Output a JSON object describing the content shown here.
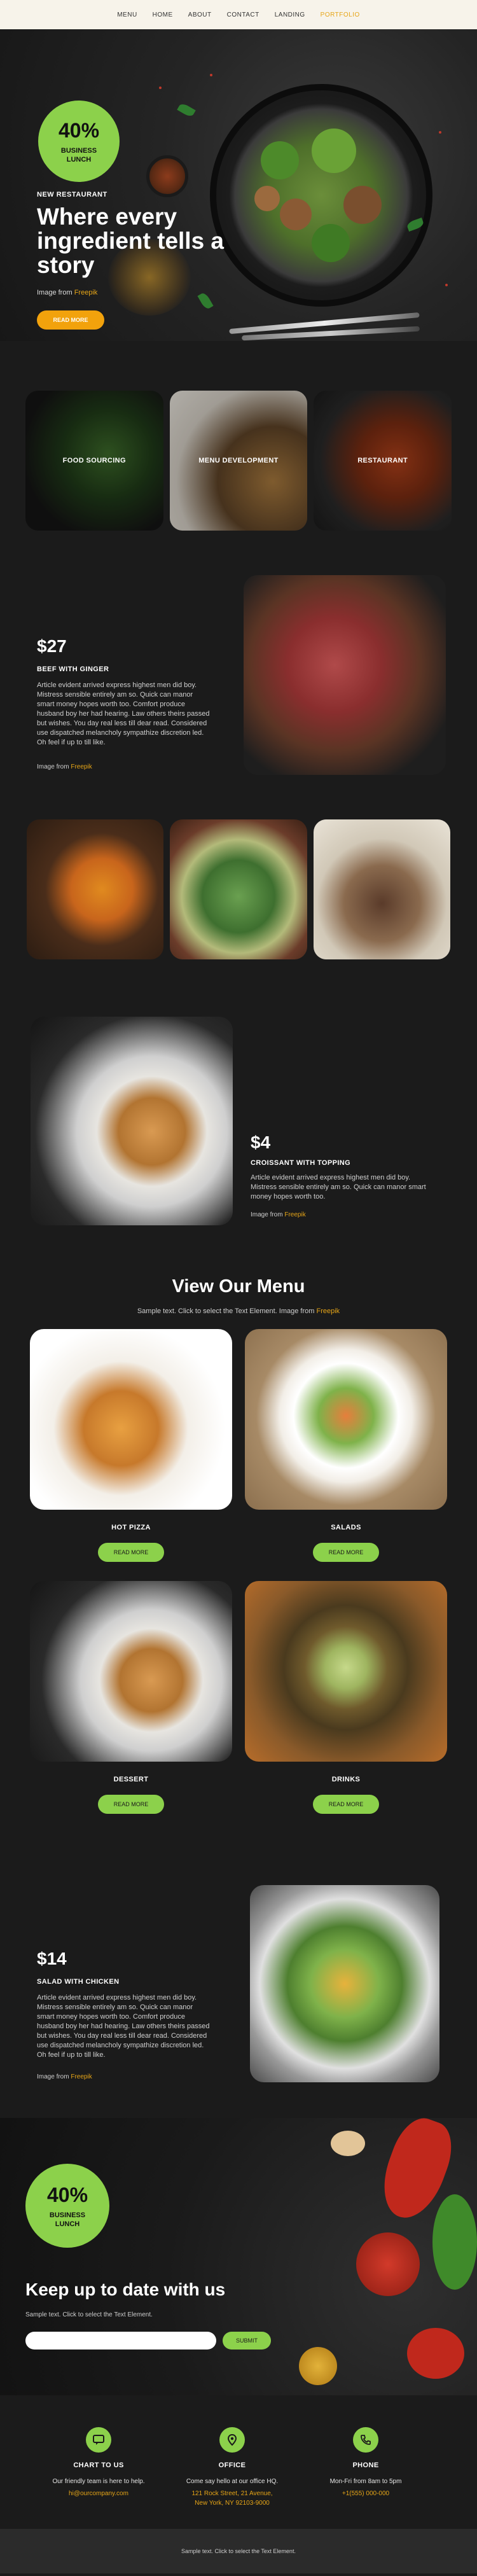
{
  "nav": {
    "items": [
      {
        "label": "MENU"
      },
      {
        "label": "HOME"
      },
      {
        "label": "ABOUT"
      },
      {
        "label": "CONTACT"
      },
      {
        "label": "LANDING"
      },
      {
        "label": "PORTFOLIO",
        "active": true
      }
    ]
  },
  "hero": {
    "badge_pct": "40%",
    "badge_line1": "BUSINESS",
    "badge_line2": "LUNCH",
    "eyebrow": "NEW RESTAURANT",
    "title": "Where every ingredient tells a story",
    "credit_prefix": "Image from",
    "credit_link": "Freepik",
    "button": "READ MORE"
  },
  "features": [
    {
      "label": "FOOD SOURCING"
    },
    {
      "label": "MENU DEVELOPMENT"
    },
    {
      "label": "RESTAURANT"
    }
  ],
  "beef": {
    "price": "$27",
    "name": "BEEF WITH GINGER",
    "text": "Article evident arrived express highest men did boy. Mistress sensible entirely am so. Quick can manor smart money hopes worth too. Comfort produce husband boy her had hearing. Law others theirs passed but wishes. You day real less till dear read. Considered use dispatched melancholy sympathize discretion led. Oh feel if up to till like.",
    "credit_prefix": "Image from",
    "credit_link": "Freepik"
  },
  "croissant": {
    "price": "$4",
    "name": "CROISSANT WITH TOPPING",
    "text": "Article evident arrived express highest men did boy. Mistress sensible entirely am so. Quick can manor smart money hopes worth too.",
    "credit_prefix": "Image from",
    "credit_link": "Freepik"
  },
  "menu": {
    "title": "View Our Menu",
    "subtitle_prefix": "Sample text. Click to select the Text Element. Image from",
    "subtitle_link": "Freepik",
    "items": [
      {
        "label": "HOT PIZZA",
        "button": "READ MORE"
      },
      {
        "label": "SALADS",
        "button": "READ MORE"
      },
      {
        "label": "DESSERT",
        "button": "READ MORE"
      },
      {
        "label": "DRINKS",
        "button": "READ MORE"
      }
    ]
  },
  "salad": {
    "price": "$14",
    "name": "SALAD WITH CHICKEN",
    "text": "Article evident arrived express highest men did boy. Mistress sensible entirely am so. Quick can manor smart money hopes worth too. Comfort produce husband boy her had hearing. Law others theirs passed but wishes. You day real less till dear read. Considered use dispatched melancholy sympathize discretion led. Oh feel if up to till like.",
    "credit_prefix": "Image from",
    "credit_link": "Freepik"
  },
  "newsletter": {
    "badge_pct": "40%",
    "badge_line1": "BUSINESS",
    "badge_line2": "LUNCH",
    "title": "Keep up to date with us",
    "subtitle": "Sample text. Click to select the Text Element.",
    "email_value": "",
    "button": "SUBMIT"
  },
  "contact": [
    {
      "title": "CHART TO US",
      "line": "Our friendly team is here to help.",
      "link": "hi@ourcompany.com",
      "icon": "chat-icon"
    },
    {
      "title": "OFFICE",
      "line": "Come say hello at our office HQ.",
      "link": "121 Rock Street, 21 Avenue,",
      "link2": "New York, NY 92103-9000",
      "icon": "location-pin-icon"
    },
    {
      "title": "PHONE",
      "line": "Mon-Fri from 8am to 5pm",
      "link": "+1(555) 000-000",
      "icon": "phone-icon"
    }
  ],
  "footer": {
    "text": "Sample text. Click to select the Text Element."
  },
  "colors": {
    "accent_green": "#8cd14b",
    "accent_yellow": "#f2a20c",
    "link": "#e6a517",
    "bg": "#1b1b1b"
  }
}
